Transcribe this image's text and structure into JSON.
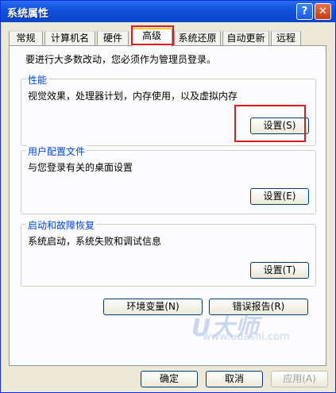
{
  "window": {
    "title": "系统属性",
    "help_glyph": "?",
    "close_glyph": "✕"
  },
  "tabs": [
    {
      "label": "常规",
      "active": false
    },
    {
      "label": "计算机名",
      "active": false
    },
    {
      "label": "硬件",
      "active": false
    },
    {
      "label": "高级",
      "active": true
    },
    {
      "label": "系统还原",
      "active": false
    },
    {
      "label": "自动更新",
      "active": false
    },
    {
      "label": "远程",
      "active": false
    }
  ],
  "panel": {
    "note": "要进行大多数改动，您必须作为管理员登录。",
    "performance": {
      "title": "性能",
      "desc": "视觉效果，处理器计划，内存使用，以及虚拟内存",
      "button": "设置(S)"
    },
    "profiles": {
      "title": "用户配置文件",
      "desc": "与您登录有关的桌面设置",
      "button": "设置(E)"
    },
    "startup": {
      "title": "启动和故障恢复",
      "desc": "系统启动，系统失败和调试信息",
      "button": "设置(T)"
    },
    "env_button": "环境变量(N)",
    "error_button": "错误报告(R)"
  },
  "watermark": {
    "logo": "U大师",
    "url": "www.udashi.com"
  },
  "footer": {
    "ok": "确定",
    "cancel": "取消",
    "apply": "应用(A)"
  },
  "colors": {
    "highlight": "#e0191e",
    "group_title": "#0046d5",
    "titlebar": "#0a46c8"
  }
}
